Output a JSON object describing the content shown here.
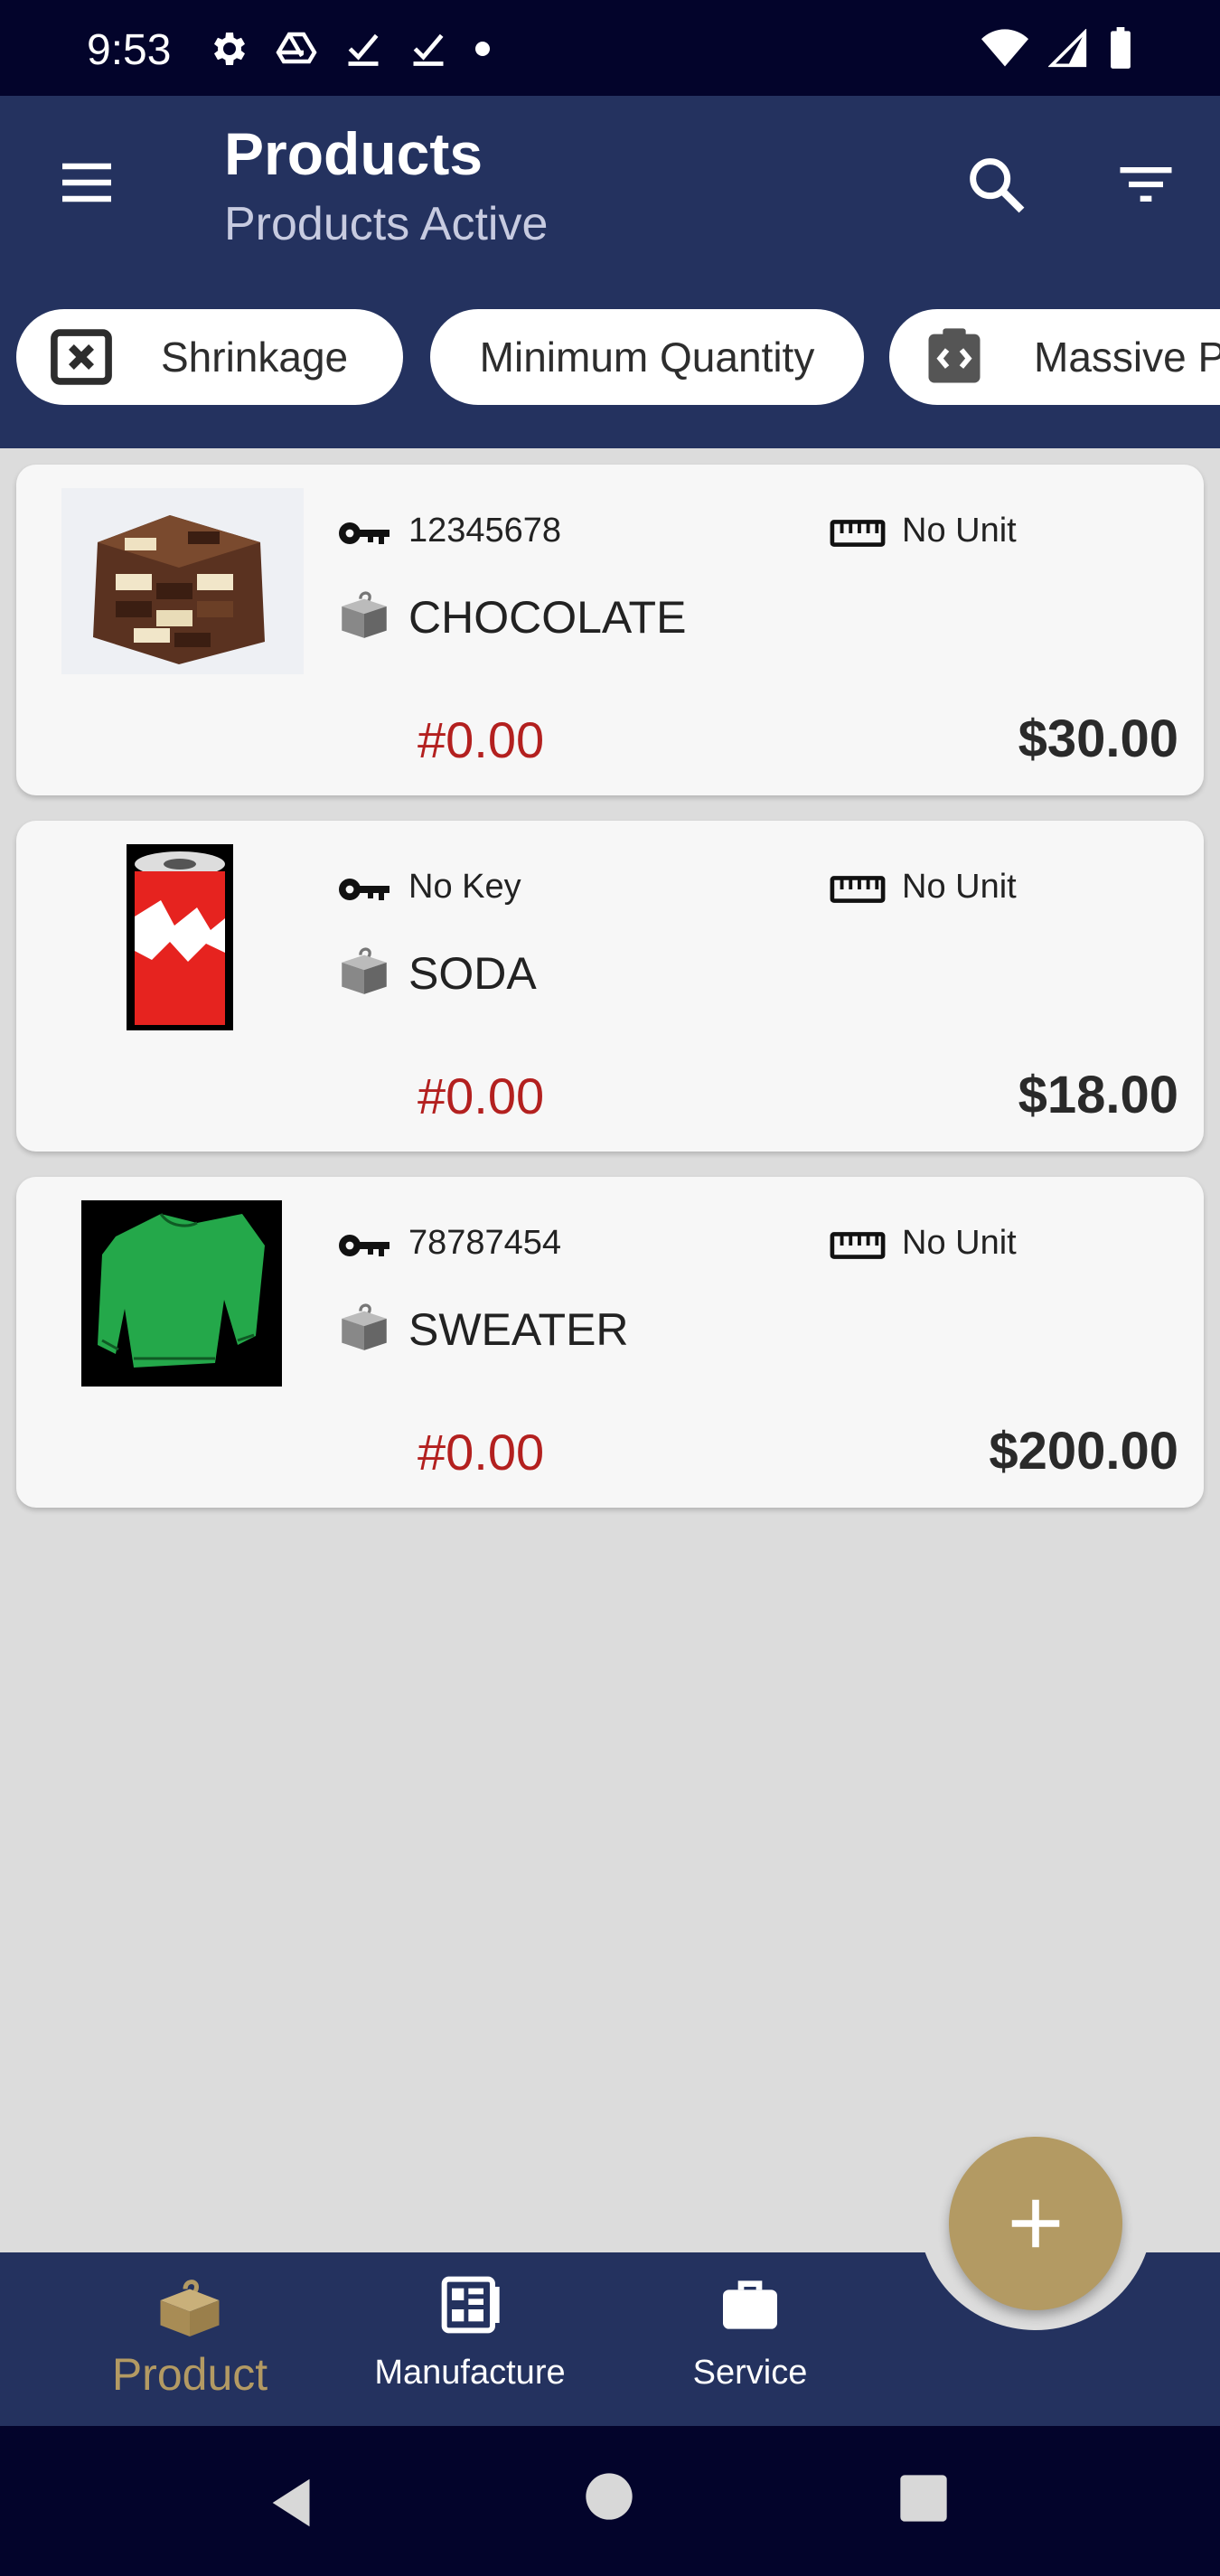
{
  "status_bar": {
    "time": "9:53",
    "left_icons": [
      "gear-icon",
      "drive-icon",
      "check-icon",
      "check-icon",
      "dot-icon"
    ],
    "right_icons": [
      "wifi-icon",
      "signal-icon",
      "battery-icon"
    ]
  },
  "app_bar": {
    "title": "Products",
    "subtitle": "Products Active"
  },
  "chips": [
    {
      "label": "Shrinkage",
      "icon": "close-box-icon"
    },
    {
      "label": "Minimum Quantity"
    },
    {
      "label": "Massive P",
      "icon": "code-clipboard-icon"
    }
  ],
  "products": [
    {
      "image": "chocolate-image",
      "key": "12345678",
      "unit": "No Unit",
      "name": "CHOCOLATE",
      "cost": "#0.00",
      "price": "$30.00"
    },
    {
      "image": "soda-can-image",
      "key": "No Key",
      "unit": "No Unit",
      "name": "SODA",
      "cost": "#0.00",
      "price": "$18.00"
    },
    {
      "image": "sweater-image",
      "key": "78787454",
      "unit": "No Unit",
      "name": "SWEATER",
      "cost": "#0.00",
      "price": "$200.00"
    }
  ],
  "bottom_nav": {
    "items": [
      {
        "label": "Product",
        "icon": "product-box-icon",
        "active": true
      },
      {
        "label": "Manufacture",
        "icon": "manufacture-icon"
      },
      {
        "label": "Service",
        "icon": "briefcase-icon"
      }
    ]
  },
  "colors": {
    "app_bar": "#24325f",
    "status_bar": "#03042b",
    "accent": "#b39a63",
    "cost_red": "#b3201f",
    "background": "#dcdcdc"
  }
}
